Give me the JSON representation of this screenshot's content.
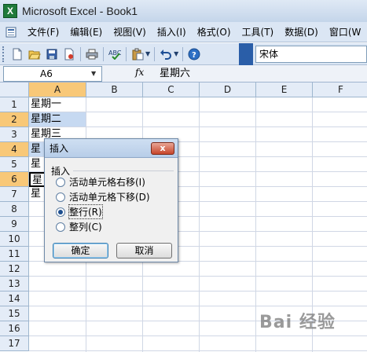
{
  "window": {
    "title": "Microsoft Excel - Book1",
    "icon": "excel-icon"
  },
  "menu": [
    "文件(F)",
    "编辑(E)",
    "视图(V)",
    "插入(I)",
    "格式(O)",
    "工具(T)",
    "数据(D)",
    "窗口(W"
  ],
  "toolbar": {
    "icons": [
      "new-icon",
      "open-icon",
      "save-icon",
      "permission-icon",
      "print-icon",
      "spellcheck-icon",
      "paste-icon",
      "undo-icon",
      "help-icon"
    ],
    "font_name": "宋体"
  },
  "formula_bar": {
    "name_box": "A6",
    "fx_label": "fx",
    "content": "星期六"
  },
  "sheet": {
    "columns": [
      "A",
      "B",
      "C",
      "D",
      "E",
      "F"
    ],
    "rows": [
      "1",
      "2",
      "3",
      "4",
      "5",
      "6",
      "7",
      "8",
      "9",
      "10",
      "11",
      "12",
      "13",
      "14",
      "15",
      "16",
      "17"
    ],
    "cells_a": [
      "星期一",
      "星期二",
      "星期三",
      "星",
      "星",
      "星",
      "星"
    ],
    "selected_rows": [
      "2",
      "4",
      "6"
    ]
  },
  "dialog": {
    "title": "插入",
    "close_label": "x",
    "group_label": "插入",
    "options": [
      {
        "label": "活动单元格右移(I)",
        "checked": false
      },
      {
        "label": "活动单元格下移(D)",
        "checked": false
      },
      {
        "label": "整行(R)",
        "checked": true
      },
      {
        "label": "整列(C)",
        "checked": false
      }
    ],
    "ok_label": "确定",
    "cancel_label": "取消"
  },
  "watermark": "Bai 经验",
  "colors": {
    "selection_header": "#f8c878",
    "selection_fill": "#c6d9f1",
    "toolbar": "#dbe6f4"
  }
}
